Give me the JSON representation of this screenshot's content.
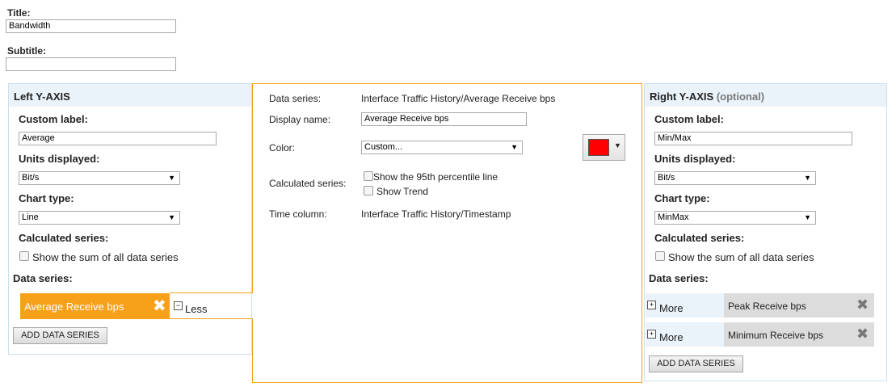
{
  "title_label": "Title:",
  "title_value": "Bandwidth",
  "subtitle_label": "Subtitle:",
  "subtitle_value": "",
  "left_axis": {
    "heading": "Left Y-AXIS",
    "custom_label_heading": "Custom label:",
    "custom_label_value": "Average",
    "units_heading": "Units displayed:",
    "units_value": "Bit/s",
    "chart_type_heading": "Chart type:",
    "chart_type_value": "Line",
    "calculated_heading": "Calculated series:",
    "sum_label": "Show the sum of all data series",
    "data_series_heading": "Data series:",
    "series": [
      {
        "name": "Average Receive bps",
        "toggle": "Less"
      }
    ],
    "add_button": "ADD DATA SERIES"
  },
  "details": {
    "data_series_label": "Data series:",
    "data_series_value": "Interface Traffic History/Average Receive bps",
    "display_name_label": "Display name:",
    "display_name_value": "Average Receive bps",
    "color_label": "Color:",
    "color_value": "Custom...",
    "swatch_color": "#ff0000",
    "calculated_label": "Calculated series:",
    "percentile_label": "Show the 95th percentile line",
    "trend_label": "Show Trend",
    "time_label": "Time column:",
    "time_value": "Interface Traffic History/Timestamp"
  },
  "right_axis": {
    "heading": "Right Y-AXIS",
    "heading_optional": "(optional)",
    "custom_label_heading": "Custom label:",
    "custom_label_value": "Min/Max",
    "units_heading": "Units displayed:",
    "units_value": "Bit/s",
    "chart_type_heading": "Chart type:",
    "chart_type_value": "MinMax",
    "calculated_heading": "Calculated series:",
    "sum_label": "Show the sum of all data series",
    "data_series_heading": "Data series:",
    "series": [
      {
        "name": "Peak Receive bps",
        "toggle": "More"
      },
      {
        "name": "Minimum Receive bps",
        "toggle": "More"
      }
    ],
    "add_button": "ADD DATA SERIES"
  },
  "colors": {
    "accent": "#f7a11a",
    "panel_border": "#cbe0ef",
    "panel_head": "#eaf3fa"
  }
}
